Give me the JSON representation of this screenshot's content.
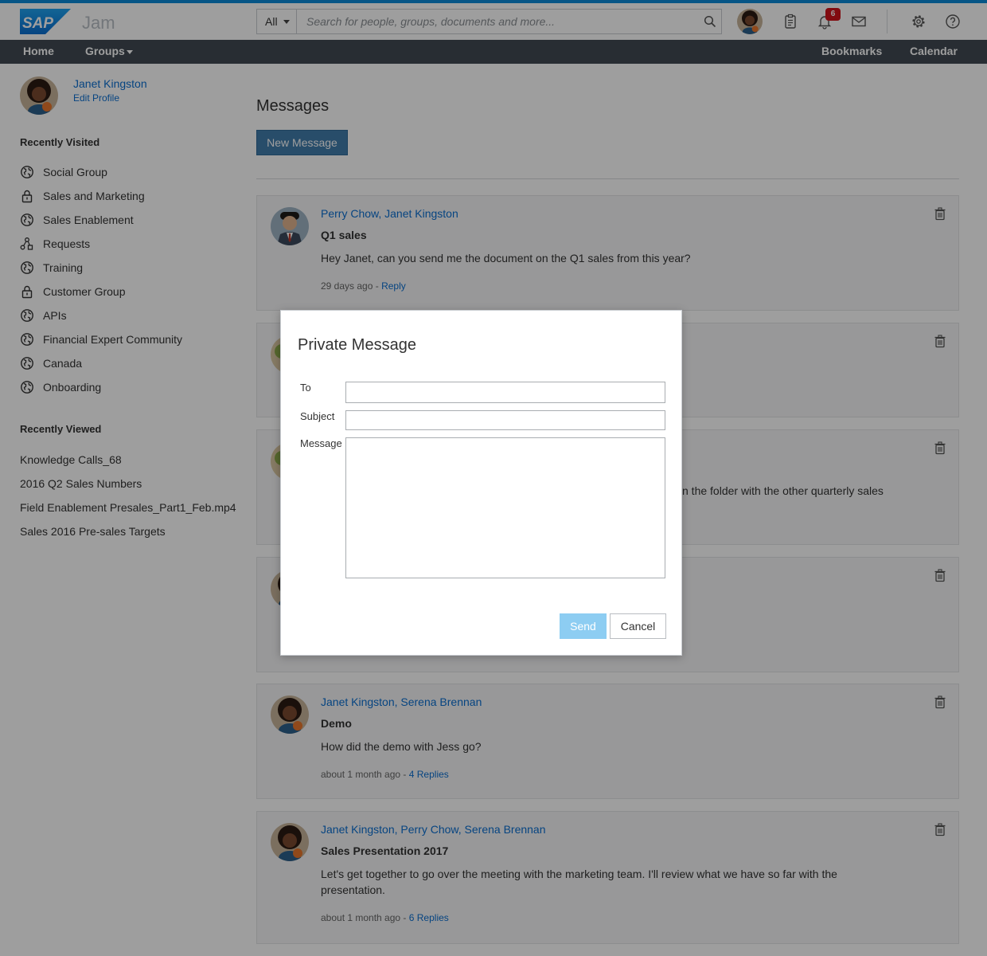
{
  "header": {
    "app_name": "Jam",
    "search_scope": "All",
    "search_placeholder": "Search for people, groups, documents and more...",
    "notification_count": "6"
  },
  "nav": {
    "home": "Home",
    "groups": "Groups",
    "bookmarks": "Bookmarks",
    "calendar": "Calendar"
  },
  "sidebar": {
    "user_name": "Janet Kingston",
    "edit_profile": "Edit Profile",
    "recently_visited_heading": "Recently Visited",
    "recently_visited": [
      {
        "label": "Social Group",
        "icon": "globe-icon"
      },
      {
        "label": "Sales and Marketing",
        "icon": "lock-icon"
      },
      {
        "label": "Sales Enablement",
        "icon": "globe-icon"
      },
      {
        "label": "Requests",
        "icon": "network-icon"
      },
      {
        "label": "Training",
        "icon": "globe-icon"
      },
      {
        "label": "Customer Group",
        "icon": "lock-icon"
      },
      {
        "label": "APIs",
        "icon": "globe-icon"
      },
      {
        "label": "Financial Expert Community",
        "icon": "globe-icon"
      },
      {
        "label": "Canada",
        "icon": "globe-icon"
      },
      {
        "label": "Onboarding",
        "icon": "globe-icon"
      }
    ],
    "recently_viewed_heading": "Recently Viewed",
    "recently_viewed": [
      "Knowledge Calls_68",
      "2016 Q2 Sales Numbers",
      "Field Enablement Presales_Part1_Feb.mp4",
      "Sales 2016 Pre-sales Targets"
    ]
  },
  "main": {
    "title": "Messages",
    "new_message_label": "New Message",
    "messages": [
      {
        "participants": "Perry Chow, Janet Kingston",
        "subject": "Q1 sales",
        "body": "Hey Janet, can you send me the document on the Q1 sales from this year?",
        "time": "29 days ago",
        "reply_link": "Reply"
      },
      {
        "partial_text": "n the folder with the other quarterly sales"
      },
      {
        "participants": "Janet Kingston, Serena Brennan",
        "subject": "Demo",
        "body": "How did the demo with Jess go?",
        "time": "about 1 month ago",
        "reply_link": "4 Replies"
      },
      {
        "participants": "Janet Kingston, Perry Chow, Serena Brennan",
        "subject": "Sales Presentation 2017",
        "body": "Let's get together to go over the meeting with the marketing team. I'll review what we have so far with the presentation.",
        "time": "about 1 month ago",
        "reply_link": "6 Replies"
      }
    ],
    "meta_separator": " - "
  },
  "dialog": {
    "title": "Private Message",
    "to_label": "To",
    "subject_label": "Subject",
    "message_label": "Message",
    "to_value": "",
    "subject_value": "",
    "message_value": "",
    "send_label": "Send",
    "cancel_label": "Cancel"
  },
  "colors": {
    "brand_blue": "#0a8ad8",
    "link_blue": "#0a6ed1",
    "nav_bg": "#414a53",
    "button_blue": "#427cac",
    "send_disabled": "#8dcdf2",
    "badge_red": "#d0121b"
  }
}
